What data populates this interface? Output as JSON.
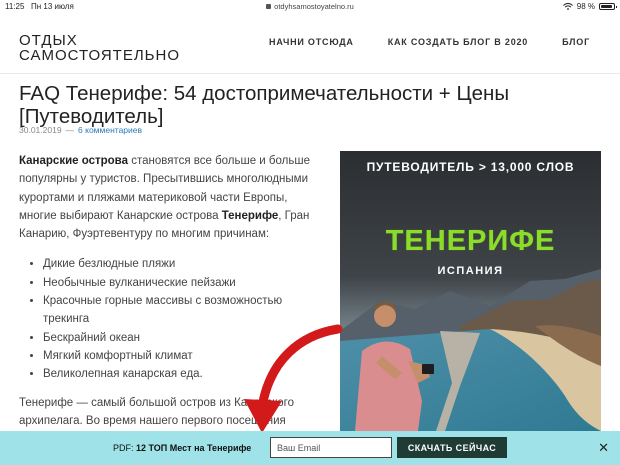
{
  "status_bar": {
    "time": "11:25",
    "date": "Пн 13 июля",
    "url": "otdyhsamostoyatelno.ru",
    "battery": "98 %"
  },
  "site": {
    "logo_line1": "ОТДЫХ",
    "logo_line2": "САМОСТОЯТЕЛЬНО",
    "nav": [
      "НАЧНИ ОТСЮДА",
      "КАК СОЗДАТЬ БЛОГ В 2020",
      "БЛОГ"
    ]
  },
  "article": {
    "title_line1": "FAQ Тенерифе: 54 достопримечательности + Цены",
    "title_line2": "[Путеводитель]",
    "date": "30.01.2019",
    "separator": "—",
    "comments": "6 комментариев",
    "intro": {
      "bold1": "Канарские острова",
      "text1": " становятся все больше и больше популярны у туристов. Пресытившись многолюдными курортами и пляжами материковой части Европы, многие выбирают Канарские острова ",
      "bold2": "Тенерифе",
      "text2": ", Гран Канарию, Фуэртевентуру по многим причинам:"
    },
    "bullets": [
      "Дикие безлюдные пляжи",
      "Необычные вулканические пейзажи",
      "Красочные горные массивы с возможностью трекинга",
      "Бескрайний океан",
      "Мягкий комфортный климат",
      "Великолепная канарская еда."
    ],
    "para2": "Тенерифе — самый большой остров из Канарского архипелага. Во время нашего первого посещения"
  },
  "guide_image": {
    "top_label": "ПУТЕВОДИТЕЛЬ > 13,000 СЛОВ",
    "city": "ТЕНЕРИФЕ",
    "country": "ИСПАНИЯ",
    "city_color": "#8cdc2c"
  },
  "bottom_bar": {
    "promo_prefix": "PDF: ",
    "promo_bold": "12 ТОП Мест на Тенерифе",
    "email_placeholder": "Ваш Email",
    "button_label": "СКАЧАТЬ СЕЙЧАС",
    "close": "✕",
    "background": "#9fe3e8"
  }
}
